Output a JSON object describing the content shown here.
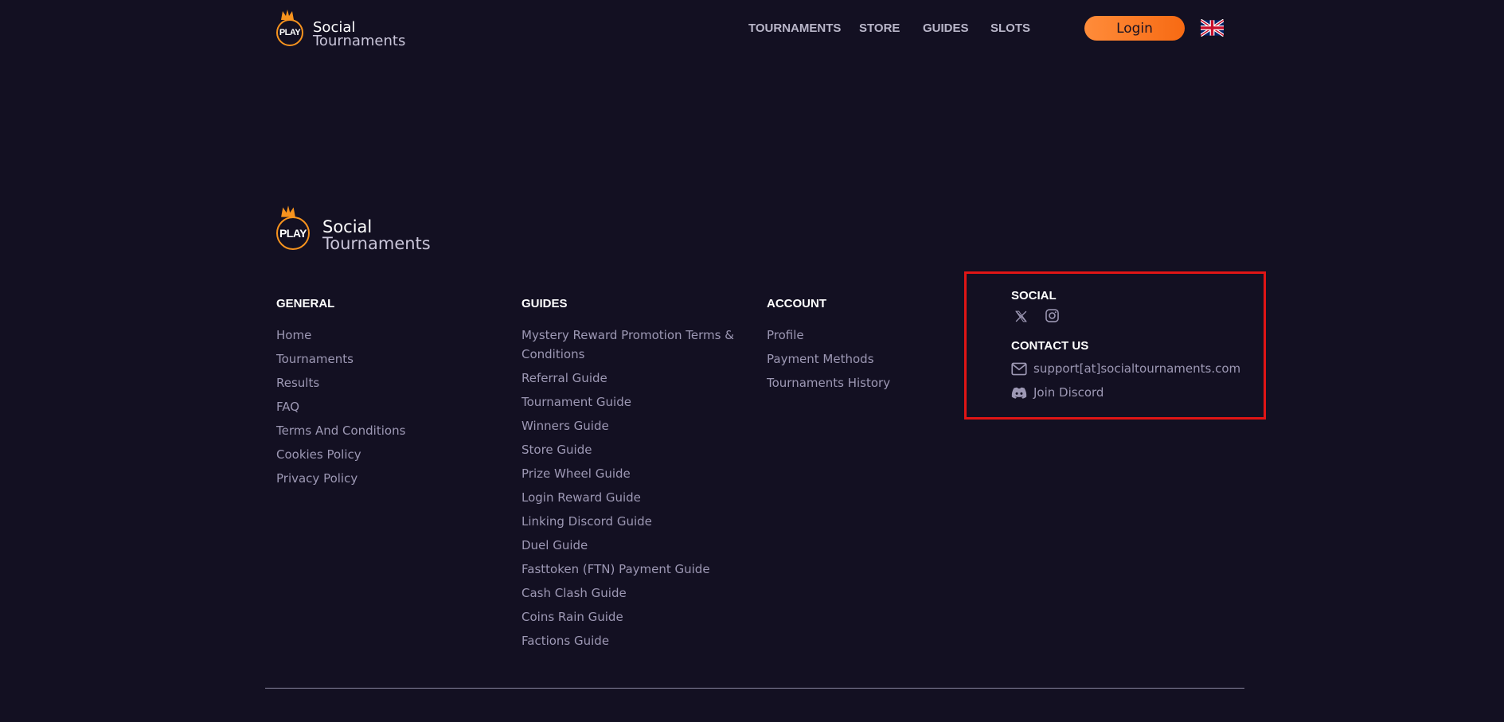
{
  "header": {
    "logo": {
      "badge": "PLAY",
      "line1": "Social",
      "line2": "Tournaments"
    },
    "nav": [
      "TOURNAMENTS",
      "STORE",
      "GUIDES",
      "SLOTS"
    ],
    "login_label": "Login",
    "language_icon": "uk-flag-icon"
  },
  "footer": {
    "logo": {
      "badge": "PLAY",
      "line1": "Social",
      "line2": "Tournaments"
    },
    "general": {
      "heading": "GENERAL",
      "links": [
        "Home",
        "Tournaments",
        "Results",
        "FAQ",
        "Terms And Conditions",
        "Cookies Policy",
        "Privacy Policy"
      ]
    },
    "guides": {
      "heading": "GUIDES",
      "links": [
        "Mystery Reward Promotion Terms & Conditions",
        "Referral Guide",
        "Tournament Guide",
        "Winners Guide",
        "Store Guide",
        "Prize Wheel Guide",
        "Login Reward Guide",
        "Linking Discord Guide",
        "Duel Guide",
        "Fasttoken (FTN) Payment Guide",
        "Cash Clash Guide",
        "Coins Rain Guide",
        "Factions Guide"
      ]
    },
    "account": {
      "heading": "ACCOUNT",
      "links": [
        "Profile",
        "Payment Methods",
        "Tournaments History"
      ]
    },
    "social": {
      "heading": "SOCIAL",
      "icons": [
        "x-icon",
        "instagram-icon"
      ]
    },
    "contact": {
      "heading": "CONTACT US",
      "email": "support[at]socialtournaments.com",
      "discord": "Join Discord"
    }
  },
  "colors": {
    "background": "#131022",
    "accent": "#f7931e",
    "login": "#ff7a26",
    "link": "#9d98b4",
    "highlight": "#e01515"
  }
}
